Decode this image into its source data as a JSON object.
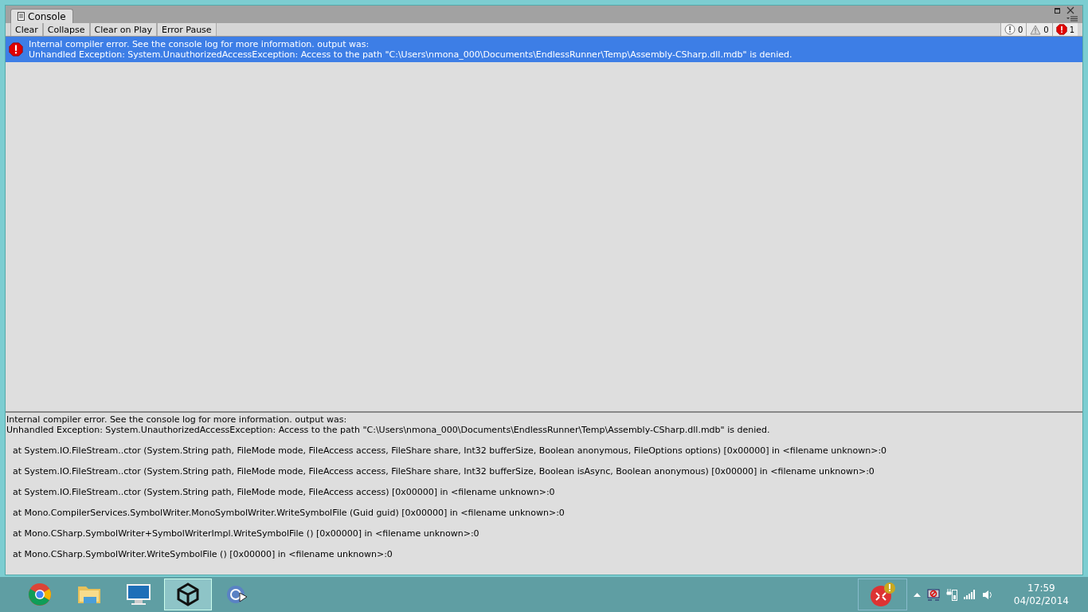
{
  "window": {
    "tab": "Console"
  },
  "toolbar": {
    "buttons": [
      {
        "label": "Clear",
        "selected": false
      },
      {
        "label": "Collapse",
        "selected": false
      },
      {
        "label": "Clear on Play",
        "selected": false
      },
      {
        "label": "Error Pause",
        "selected": false
      }
    ],
    "counters": [
      {
        "kind": "info",
        "count": "0"
      },
      {
        "kind": "warning",
        "count": "0"
      },
      {
        "kind": "error",
        "count": "1"
      }
    ]
  },
  "log": [
    {
      "kind": "error",
      "selected": true,
      "lines": [
        "Internal compiler error. See the console log for more information. output was:",
        "Unhandled Exception: System.UnauthorizedAccessException: Access to the path \"C:\\Users\\nmona_000\\Documents\\EndlessRunner\\Temp\\Assembly-CSharp.dll.mdb\" is denied."
      ]
    }
  ],
  "detail": {
    "header": [
      "Internal compiler error. See the console log for more information. output was:",
      "Unhandled Exception: System.UnauthorizedAccessException: Access to the path \"C:\\Users\\nmona_000\\Documents\\EndlessRunner\\Temp\\Assembly-CSharp.dll.mdb\" is denied."
    ],
    "stack": [
      "at System.IO.FileStream..ctor (System.String path, FileMode mode, FileAccess access, FileShare share, Int32 bufferSize, Boolean anonymous, FileOptions options) [0x00000] in <filename unknown>:0",
      "at System.IO.FileStream..ctor (System.String path, FileMode mode, FileAccess access, FileShare share, Int32 bufferSize, Boolean isAsync, Boolean anonymous) [0x00000] in <filename unknown>:0",
      "at System.IO.FileStream..ctor (System.String path, FileMode mode, FileAccess access) [0x00000] in <filename unknown>:0",
      "at Mono.CompilerServices.SymbolWriter.MonoSymbolWriter.WriteSymbolFile (Guid guid) [0x00000] in <filename unknown>:0",
      "at Mono.CSharp.SymbolWriter+SymbolWriterImpl.WriteSymbolFile () [0x00000] in <filename unknown>:0",
      "at Mono.CSharp.SymbolWriter.WriteSymbolFile () [0x00000] in <filename unknown>:0"
    ]
  },
  "taskbar": {
    "apps": [
      {
        "kind": "chrome",
        "selected": false
      },
      {
        "kind": "folder",
        "selected": false
      },
      {
        "kind": "monitor",
        "selected": false
      },
      {
        "kind": "unity",
        "selected": true
      },
      {
        "kind": "monodevelop",
        "selected": false
      }
    ],
    "clock": {
      "time": "17:59",
      "date": "04/02/2014"
    }
  }
}
